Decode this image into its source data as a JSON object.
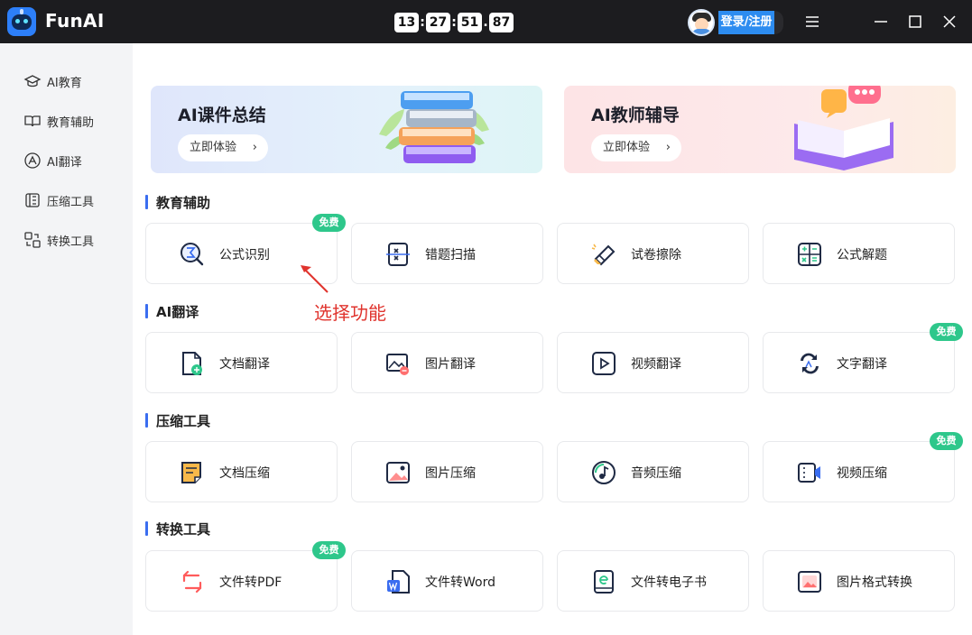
{
  "app": {
    "name": "FunAI"
  },
  "clock": {
    "hours": "13",
    "minutes": "27",
    "seconds": "51",
    "centis": "87",
    "sep1": ":",
    "sep2": ":",
    "sep3": "."
  },
  "header": {
    "login_label": "登录/注册"
  },
  "sidebar": {
    "items": [
      {
        "label": "AI教育",
        "icon": "graduation-cap-icon"
      },
      {
        "label": "教育辅助",
        "icon": "open-book-icon"
      },
      {
        "label": "AI翻译",
        "icon": "translate-icon"
      },
      {
        "label": "压缩工具",
        "icon": "compress-icon"
      },
      {
        "label": "转换工具",
        "icon": "convert-icon"
      }
    ]
  },
  "banners": [
    {
      "title": "AI课件总结",
      "button": "立即体验",
      "chevron": "›"
    },
    {
      "title": "AI教师辅导",
      "button": "立即体验",
      "chevron": "›"
    }
  ],
  "sections": [
    {
      "title": "教育辅助",
      "cards": [
        {
          "label": "公式识别",
          "icon": "formula-icon",
          "badge": "免费"
        },
        {
          "label": "错题扫描",
          "icon": "scan-icon",
          "badge": ""
        },
        {
          "label": "试卷擦除",
          "icon": "eraser-icon",
          "badge": ""
        },
        {
          "label": "公式解题",
          "icon": "calculator-icon",
          "badge": ""
        }
      ]
    },
    {
      "title": "AI翻译",
      "cards": [
        {
          "label": "文档翻译",
          "icon": "doc-translate-icon",
          "badge": ""
        },
        {
          "label": "图片翻译",
          "icon": "image-translate-icon",
          "badge": ""
        },
        {
          "label": "视频翻译",
          "icon": "video-translate-icon",
          "badge": ""
        },
        {
          "label": "文字翻译",
          "icon": "text-translate-icon",
          "badge": "免费"
        }
      ]
    },
    {
      "title": "压缩工具",
      "cards": [
        {
          "label": "文档压缩",
          "icon": "doc-compress-icon",
          "badge": ""
        },
        {
          "label": "图片压缩",
          "icon": "image-compress-icon",
          "badge": ""
        },
        {
          "label": "音频压缩",
          "icon": "audio-compress-icon",
          "badge": ""
        },
        {
          "label": "视频压缩",
          "icon": "video-compress-icon",
          "badge": "免费"
        }
      ]
    },
    {
      "title": "转换工具",
      "cards": [
        {
          "label": "文件转PDF",
          "icon": "file-to-pdf-icon",
          "badge": "免费"
        },
        {
          "label": "文件转Word",
          "icon": "file-to-word-icon",
          "badge": ""
        },
        {
          "label": "文件转电子书",
          "icon": "file-to-ebook-icon",
          "badge": ""
        },
        {
          "label": "图片格式转换",
          "icon": "image-format-icon",
          "badge": ""
        }
      ]
    }
  ],
  "annotation": {
    "text": "选择功能"
  },
  "colors": {
    "titlebar": "#1c1c1f",
    "accent": "#3a6df0",
    "badge": "#2ec78b",
    "annotation": "#e0342e",
    "login": "#2d8cf0"
  }
}
